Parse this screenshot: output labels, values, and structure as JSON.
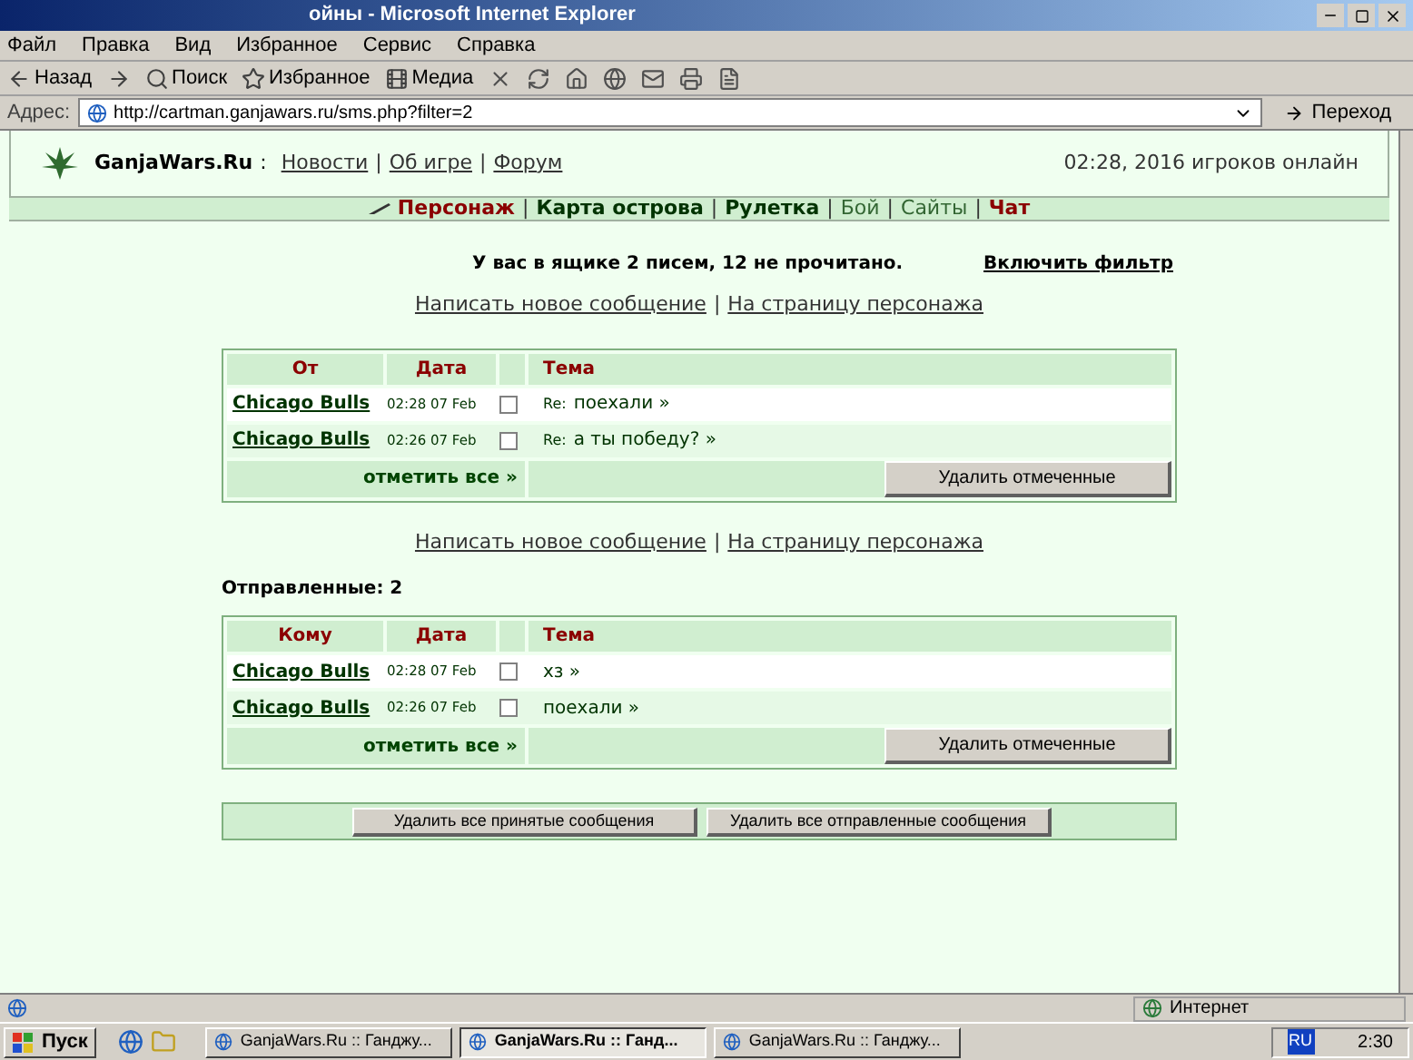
{
  "window": {
    "title": "ойны - Microsoft Internet Explorer"
  },
  "menu": [
    "Файл",
    "Правка",
    "Вид",
    "Избранное",
    "Сервис",
    "Справка"
  ],
  "toolbar": [
    {
      "label": "Назад",
      "kind": "back"
    },
    {
      "kind": "forward"
    },
    {
      "label": "Поиск",
      "kind": "search"
    },
    {
      "label": "Избранное",
      "kind": "favorites"
    },
    {
      "label": "Медиа",
      "kind": "media"
    }
  ],
  "address": {
    "label": "Адрес:",
    "value": "http://cartman.ganjawars.ru/sms.php?filter=2",
    "go": "Переход"
  },
  "header": {
    "logo": "GanjaWars.Ru",
    "separator": ":",
    "links": [
      {
        "kind": "link",
        "label": "Новости"
      },
      {
        "kind": "separator",
        "label": "|"
      },
      {
        "kind": "link",
        "label": "Об игре"
      },
      {
        "kind": "separator",
        "label": "|"
      },
      {
        "kind": "link",
        "label": "Форум"
      }
    ],
    "status": "02:28, 2016 игроков онлайн"
  },
  "nav": [
    {
      "label": "Персонаж",
      "kind": "active"
    },
    {
      "label": "|",
      "kind": "separator"
    },
    {
      "label": "Карта острова",
      "kind": "bold"
    },
    {
      "label": "|",
      "kind": "separator"
    },
    {
      "label": "Рулетка",
      "kind": "bold"
    },
    {
      "label": "|",
      "kind": "separator"
    },
    {
      "label": "Бой",
      "kind": "plain"
    },
    {
      "label": "|",
      "kind": "separator"
    },
    {
      "label": "Сайты",
      "kind": "plain"
    },
    {
      "label": "|",
      "kind": "separator"
    },
    {
      "label": "Чат",
      "kind": "alert"
    }
  ],
  "summary": "У вас в ящике 2 писем, 12 не прочитано.",
  "filter_link": "Включить фильтр",
  "actions_top": [
    {
      "kind": "link",
      "label": "Написать новое сообщение"
    },
    {
      "kind": "separator",
      "label": "|"
    },
    {
      "kind": "link",
      "label": "На страницу персонажа"
    }
  ],
  "inbox": {
    "columns": [
      "От",
      "Дата",
      "Тема"
    ],
    "rows": [
      {
        "name": "Chicago Bulls",
        "date": "02:28 07 Feb",
        "checked": false,
        "prefix": "Re:",
        "subject": "поехали »"
      },
      {
        "name": "Chicago Bulls",
        "date": "02:26 07 Feb",
        "checked": false,
        "prefix": "Re:",
        "subject": "а ты победу? »"
      }
    ],
    "mark_all": "отметить все »",
    "delete": "Удалить отмеченные"
  },
  "actions_middle": [
    {
      "kind": "link",
      "label": "Написать новое сообщение"
    },
    {
      "kind": "separator",
      "label": "|"
    },
    {
      "kind": "link",
      "label": "На страницу персонажа"
    }
  ],
  "sent_label": "Отправленные: 2",
  "sent": {
    "columns": [
      "Кому",
      "Дата",
      "Тема"
    ],
    "rows": [
      {
        "name": "Chicago Bulls",
        "date": "02:28 07 Feb",
        "checked": false,
        "subject": "хз »"
      },
      {
        "name": "Chicago Bulls",
        "date": "02:26 07 Feb",
        "checked": false,
        "subject": "поехали »"
      }
    ],
    "mark_all": "отметить все »",
    "delete": "Удалить отмеченные"
  },
  "bottom_buttons": [
    "Удалить все принятые сообщения",
    "Удалить все отправленные сообщения"
  ],
  "status_bar": {
    "zone": "Интернет"
  },
  "taskbar": {
    "start": "Пуск",
    "tasks": [
      {
        "label": "GanjaWars.Ru :: Ганджу...",
        "selected": false
      },
      {
        "label": "GanjaWars.Ru :: Ганд...",
        "selected": true
      },
      {
        "label": "GanjaWars.Ru :: Ганджу...",
        "selected": false
      }
    ],
    "language": "RU",
    "clock": "2:30"
  }
}
